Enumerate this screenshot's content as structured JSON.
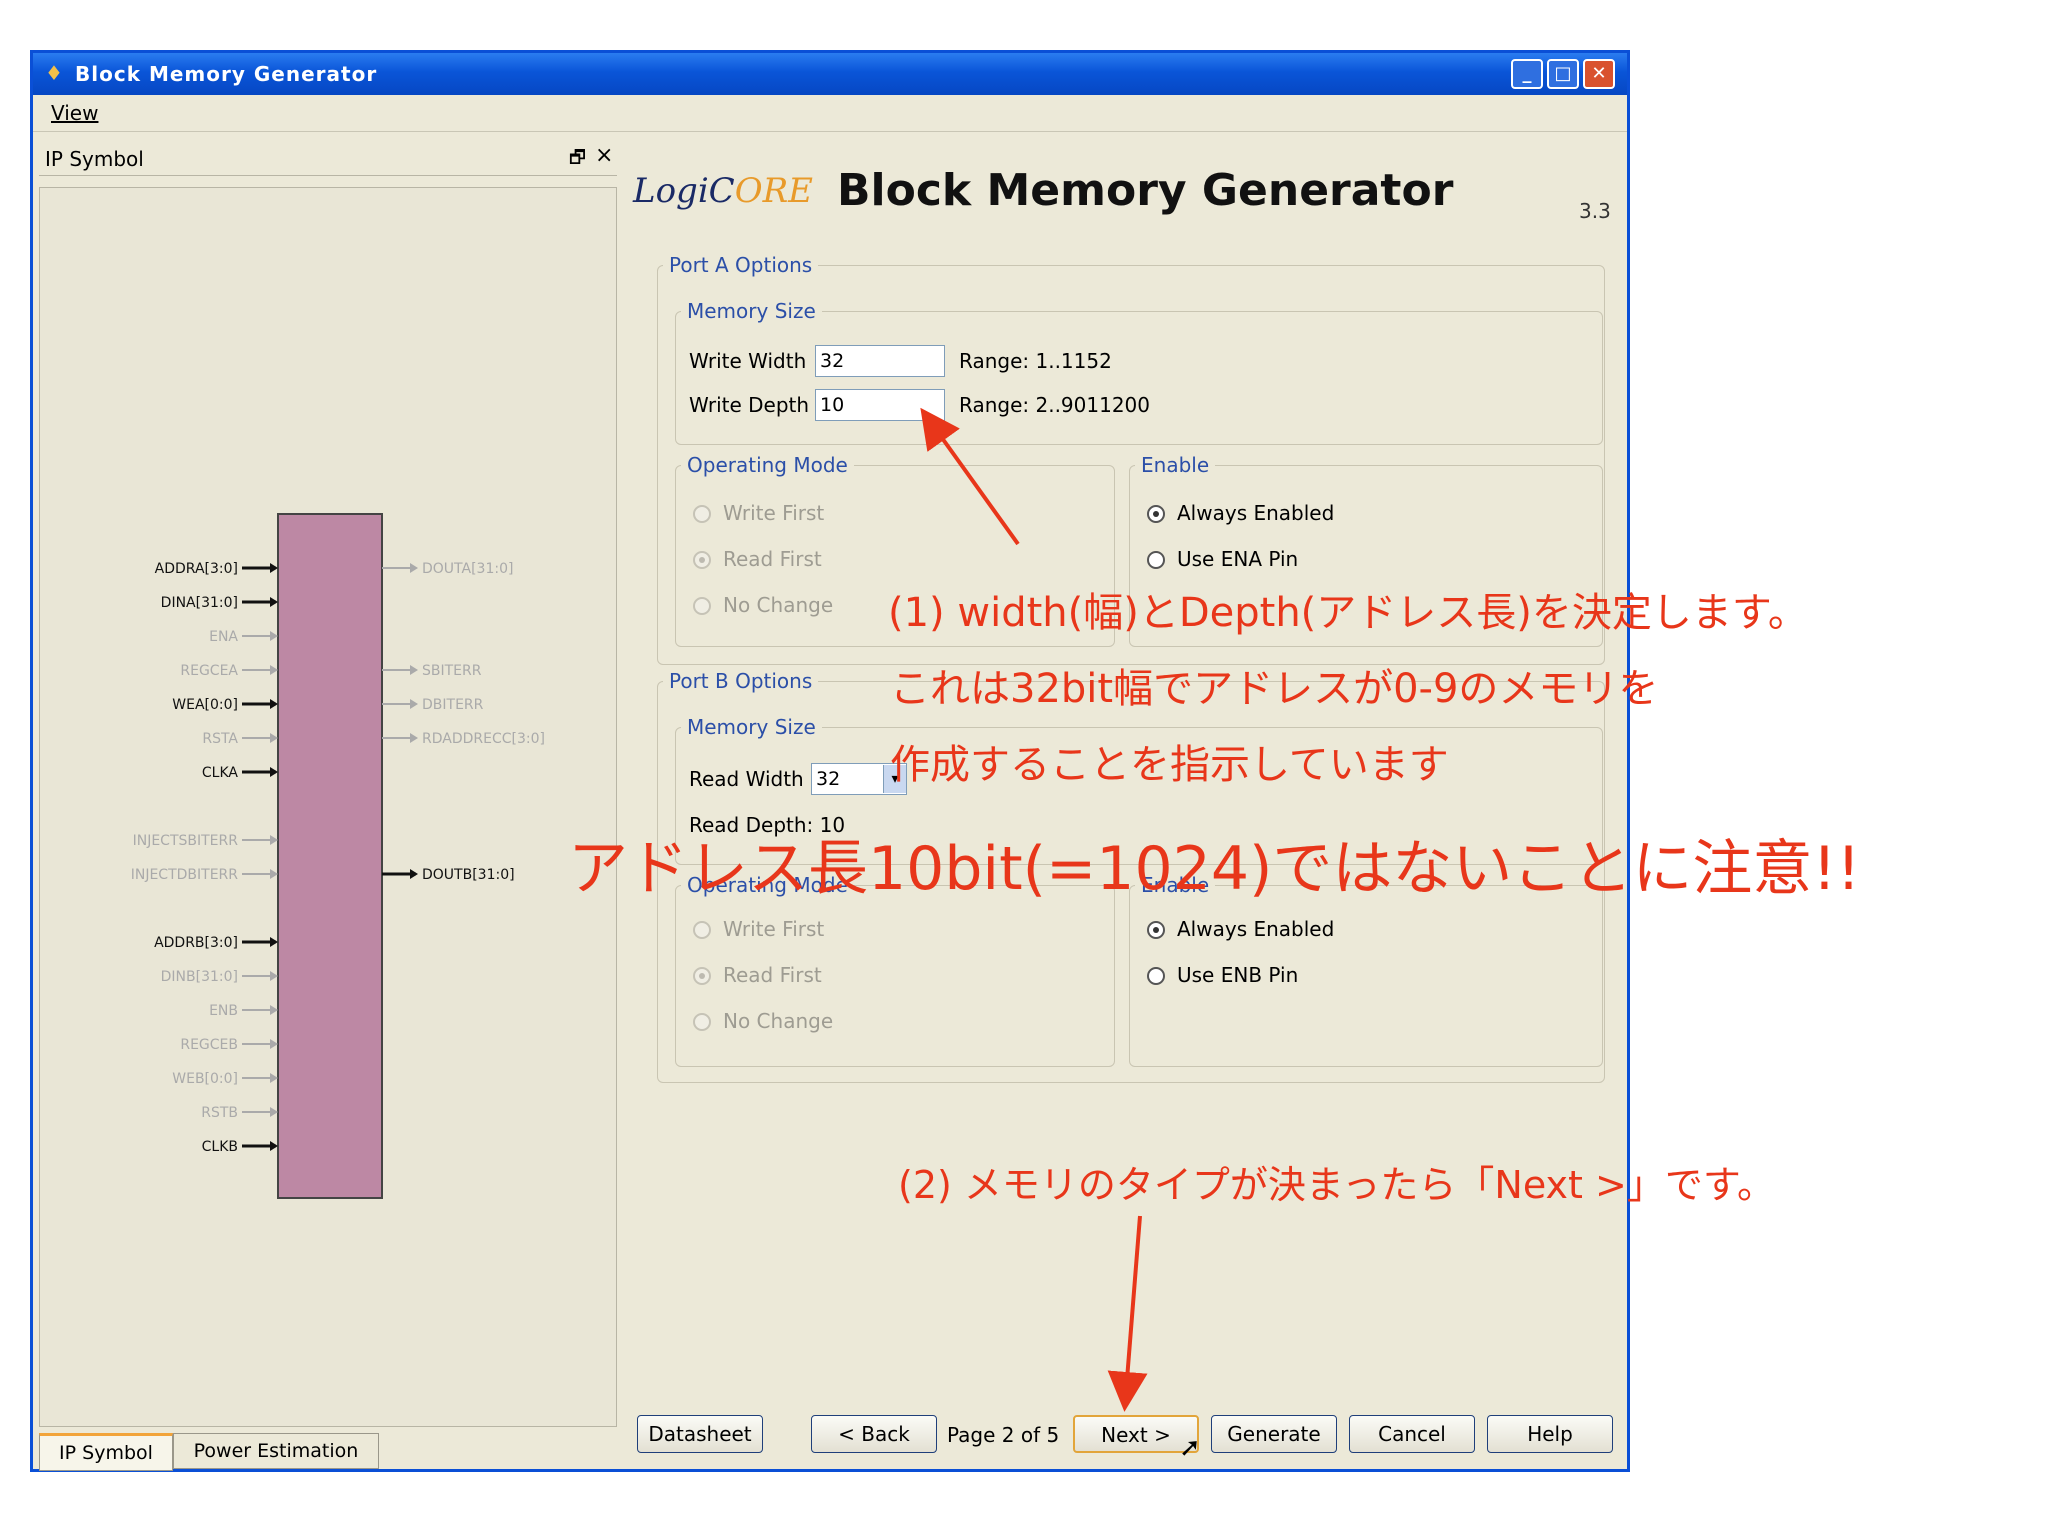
{
  "window": {
    "title": "Block Memory Generator",
    "controls": {
      "minimize": "_",
      "maximize": "□",
      "close": "✕"
    }
  },
  "menu": {
    "view": "View"
  },
  "left_panel": {
    "title": "IP Symbol",
    "restore_icon": "🗗",
    "close_icon": "×",
    "tabs": [
      "IP Symbol",
      "Power Estimation"
    ],
    "symbol": {
      "left_pins": [
        {
          "label": "ADDRA[3:0]",
          "active": true
        },
        {
          "label": "DINA[31:0]",
          "active": true
        },
        {
          "label": "ENA",
          "active": false
        },
        {
          "label": "REGCEA",
          "active": false
        },
        {
          "label": "WEA[0:0]",
          "active": true
        },
        {
          "label": "RSTA",
          "active": false
        },
        {
          "label": "CLKA",
          "active": true
        },
        {
          "label": "INJECTSBITERR",
          "active": false
        },
        {
          "label": "INJECTDBITERR",
          "active": false
        },
        {
          "label": "ADDRB[3:0]",
          "active": true
        },
        {
          "label": "DINB[31:0]",
          "active": false
        },
        {
          "label": "ENB",
          "active": false
        },
        {
          "label": "REGCEB",
          "active": false
        },
        {
          "label": "WEB[0:0]",
          "active": false
        },
        {
          "label": "RSTB",
          "active": false
        },
        {
          "label": "CLKB",
          "active": true
        }
      ],
      "right_pins": [
        {
          "label": "DOUTA[31:0]",
          "active": false
        },
        {
          "label": "SBITERR",
          "active": false
        },
        {
          "label": "DBITERR",
          "active": false
        },
        {
          "label": "RDADDRECC[3:0]",
          "active": false
        },
        {
          "label": "DOUTB[31:0]",
          "active": true
        }
      ],
      "block_color": "#bd88a4"
    }
  },
  "header": {
    "logo_prefix": "LogiC",
    "logo_mid": "O",
    "logo_suffix": "RE",
    "title": "Block Memory Generator",
    "version": "3.3"
  },
  "port_a": {
    "label": "Port A Options",
    "memory_size": {
      "label": "Memory Size",
      "write_width_label": "Write Width",
      "write_width_value": "32",
      "write_width_range": "Range: 1..1152",
      "write_depth_label": "Write Depth",
      "write_depth_value": "10",
      "write_depth_range": "Range: 2..9011200"
    },
    "operating_mode": {
      "label": "Operating Mode",
      "options": [
        "Write First",
        "Read First",
        "No Change"
      ],
      "selected": "Read First"
    },
    "enable": {
      "label": "Enable",
      "options": [
        "Always Enabled",
        "Use ENA Pin"
      ],
      "selected": "Always Enabled"
    }
  },
  "port_b": {
    "label": "Port B Options",
    "memory_size": {
      "label": "Memory Size",
      "read_width_label": "Read Width",
      "read_width_value": "32",
      "read_depth_text": "Read Depth: 10"
    },
    "operating_mode": {
      "label": "Operating Mode",
      "options": [
        "Write First",
        "Read First",
        "No Change"
      ],
      "selected": "Read First"
    },
    "enable": {
      "label": "Enable",
      "options": [
        "Always Enabled",
        "Use ENB Pin"
      ],
      "selected": "Always Enabled"
    }
  },
  "footer": {
    "datasheet": "Datasheet",
    "back": "< Back",
    "page": "Page 2 of 5",
    "next": "Next >",
    "generate": "Generate",
    "cancel": "Cancel",
    "help": "Help"
  },
  "annotations": {
    "note1_line1": "(1) width(幅)とDepth(アドレス長)を決定します。",
    "note1_line2": "これは32bit幅でアドレスが0-9のメモリを",
    "note1_line3": "作成することを指示しています",
    "warning": "アドレス長10bit(=1024)ではないことに注意!!",
    "note2": "(2) メモリのタイプが決まったら「Next >」です。",
    "color": "#e8361a"
  }
}
